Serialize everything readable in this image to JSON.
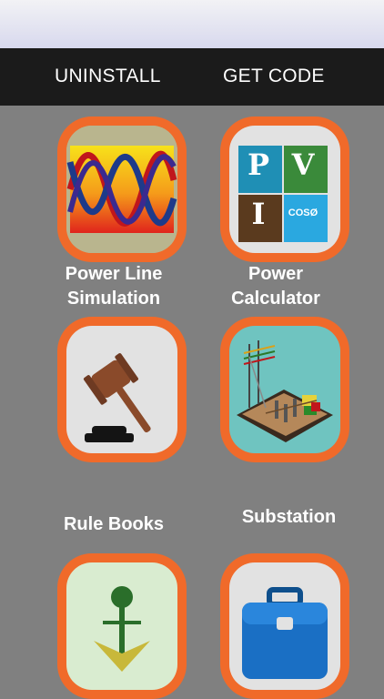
{
  "topbar": {
    "uninstall_label": "UNINSTALL",
    "get_code_label": "GET CODE"
  },
  "colors": {
    "background": "#808080",
    "tile_border": "#f06a2a",
    "topbar": "#1b1b1b"
  },
  "apps": {
    "power_line": {
      "label_line1": "Power Line",
      "label_line2": "Simulation",
      "icon": "sine-waves-icon"
    },
    "power_calc": {
      "label_line1": "Power",
      "label_line2": "Calculator",
      "icon": "pvi-icon",
      "tiles": [
        "P",
        "V",
        "I",
        "COSØ"
      ]
    },
    "rule_books": {
      "label": "Rule Books",
      "icon": "gavel-icon"
    },
    "substation": {
      "label": "Substation",
      "icon": "substation-icon"
    },
    "grounding": {
      "icon": "ground-anchor-icon"
    },
    "toolbox": {
      "icon": "toolbox-icon"
    }
  }
}
